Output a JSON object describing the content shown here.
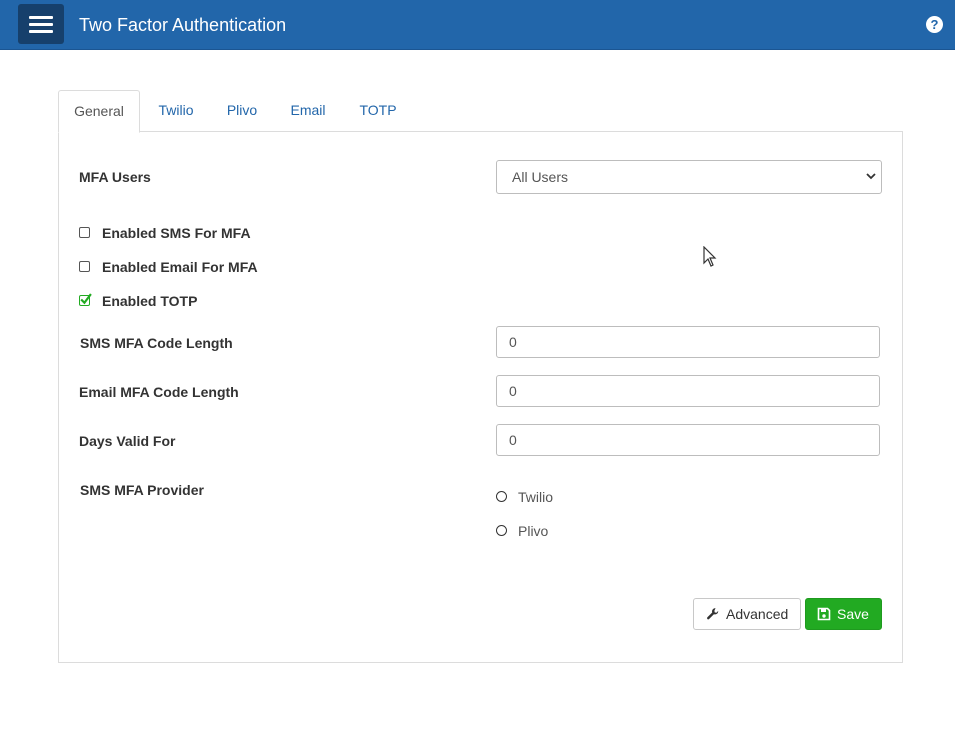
{
  "header": {
    "title": "Two Factor Authentication",
    "menu_icon": "hamburger-menu-icon",
    "help_icon": "question-circle-icon",
    "help_glyph": "?"
  },
  "tabs": [
    {
      "label": "General",
      "active": true
    },
    {
      "label": "Twilio",
      "active": false
    },
    {
      "label": "Plivo",
      "active": false
    },
    {
      "label": "Email",
      "active": false
    },
    {
      "label": "TOTP",
      "active": false
    }
  ],
  "form": {
    "mfa_users": {
      "label": "MFA Users",
      "value": "All Users"
    },
    "checkboxes": [
      {
        "label": "Enabled SMS For MFA",
        "checked": false
      },
      {
        "label": "Enabled Email For MFA",
        "checked": false
      },
      {
        "label": "Enabled TOTP",
        "checked": true
      }
    ],
    "sms_code_length": {
      "label": "SMS MFA Code Length",
      "value": "0"
    },
    "email_code_length": {
      "label": "Email MFA Code Length",
      "value": "0"
    },
    "days_valid": {
      "label": "Days Valid For",
      "value": "0"
    },
    "sms_provider": {
      "label": "SMS MFA Provider",
      "options": [
        "Twilio",
        "Plivo"
      ]
    }
  },
  "actions": {
    "advanced_label": "Advanced",
    "save_label": "Save"
  },
  "colors": {
    "header_bg": "#2266aa",
    "menu_btn_bg": "#16406c",
    "link": "#2266aa",
    "success": "#22aa22"
  }
}
